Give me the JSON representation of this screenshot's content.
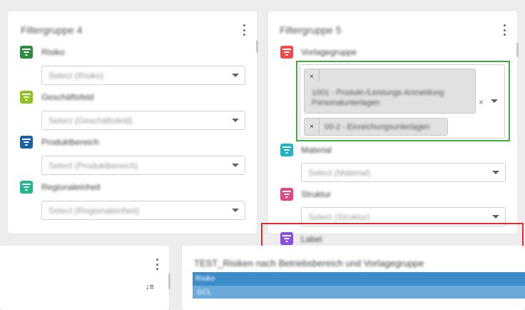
{
  "panels": [
    {
      "title": "Filtergruppe 4",
      "filters": [
        {
          "label": "Risiko",
          "placeholder": "Select (Risiko)",
          "color": "#2e8b3e"
        },
        {
          "label": "Geschäftsfeld",
          "placeholder": "Select (Geschäftsfeld)",
          "color": "#8dc21f"
        },
        {
          "label": "Produktbereich",
          "placeholder": "Select (Produktbereich)",
          "color": "#1f5fa8"
        },
        {
          "label": "Regionaleinheit",
          "placeholder": "Select (Regionaleinheit)",
          "color": "#21b98c"
        }
      ]
    },
    {
      "title": "Filtergruppe 5",
      "filters": [
        {
          "label": "Vorlagegruppe",
          "color": "#ef4b4b"
        },
        {
          "label": "Material",
          "placeholder": "Select (Material)",
          "color": "#1fb5c9"
        },
        {
          "label": "Struktur",
          "placeholder": "Select (Struktur)",
          "color": "#e54581"
        },
        {
          "label": "Label",
          "color": "#8a4be8"
        }
      ]
    }
  ],
  "selected_chips": [
    {
      "remove_glyph": "×",
      "text": "1001 - Produkt-/Leistungs-Anmeldung Personalunterlagen"
    },
    {
      "remove_glyph": "×",
      "text": "00-2 - Einreichungsunterlagen"
    }
  ],
  "multi_clear_glyph": "×",
  "bottom": {
    "chart_title": "TEST_Risiken nach Betriebsbereich und Vorlagegruppe",
    "table_header_cell": "Risiko",
    "table_row_cell": "GCL",
    "sort_icon": "↓≡"
  }
}
